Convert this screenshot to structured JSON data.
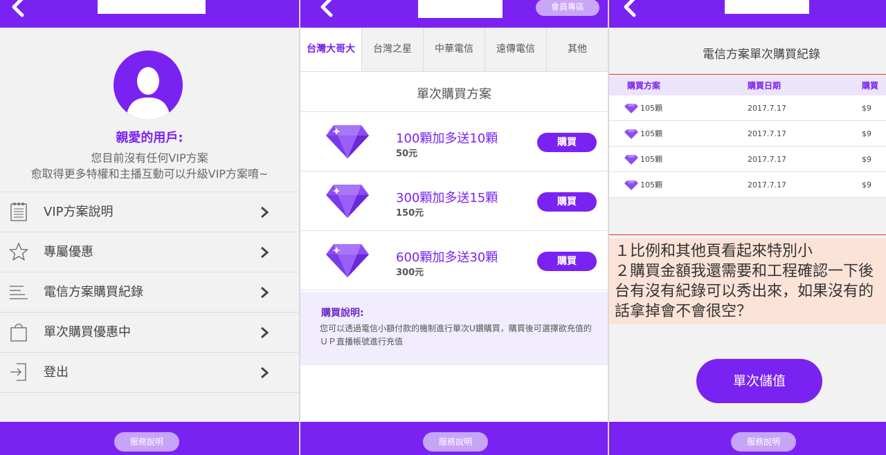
{
  "colors": {
    "accent": "#7a22f2",
    "accent_light": "#c6a4f6",
    "annotation_bg": "#fbe3d8",
    "annotation_border": "#e0322b"
  },
  "panel1": {
    "greeting": {
      "title": "親愛的用戶:",
      "line1": "您目前沒有任何VIP方案",
      "line2": "愈取得更多特權和主播互動可以升級VIP方案唷~"
    },
    "menu": [
      {
        "label": "VIP方案說明",
        "icon": "notepad-icon"
      },
      {
        "label": "專屬優惠",
        "icon": "star-icon"
      },
      {
        "label": "電信方案購買紀錄",
        "icon": "list-icon"
      },
      {
        "label": "單次購買優惠中",
        "icon": "shopping-bag-icon"
      },
      {
        "label": "登出",
        "icon": "logout-icon"
      }
    ],
    "service_label": "服務說明"
  },
  "panel2": {
    "member_label": "會員專區",
    "tabs": [
      "台灣大哥大",
      "台灣之星",
      "中華電信",
      "遠傳電信",
      "其他"
    ],
    "active_tab": "台灣大哥大",
    "section_title": "單次購買方案",
    "plans": [
      {
        "title": "100顆加多送10顆",
        "price": "50元",
        "button": "購買"
      },
      {
        "title": "300顆加多送15顆",
        "price": "150元",
        "button": "購買"
      },
      {
        "title": "600顆加多送30顆",
        "price": "300元",
        "button": "購買"
      }
    ],
    "explain": {
      "title": "購買說明:",
      "text": "您可以透過電信小額付款的機制進行單次U鑽購買，購買後可選擇欲充值的ＵＰ直播帳號進行充值"
    },
    "service_label": "服務說明"
  },
  "panel3": {
    "title": "電信方案單次購買紀錄",
    "table": {
      "headers": [
        "購買方案",
        "購買日期",
        "購買金"
      ],
      "rows": [
        {
          "plan": "105顆",
          "date": "2017.7.17",
          "amount": "$9"
        },
        {
          "plan": "105顆",
          "date": "2017.7.17",
          "amount": "$9"
        },
        {
          "plan": "105顆",
          "date": "2017.7.17",
          "amount": "$9"
        },
        {
          "plan": "105顆",
          "date": "2017.7.17",
          "amount": "$9"
        }
      ]
    },
    "note_lines": [
      "１比例和其他頁看起來特別小",
      "２購買金額我還需要和工程確認一下後",
      "台有沒有紀錄可以秀出來，如果沒有的",
      "話拿掉會不會很空？"
    ],
    "topup_label": "單次儲值",
    "service_label": "服務說明"
  }
}
